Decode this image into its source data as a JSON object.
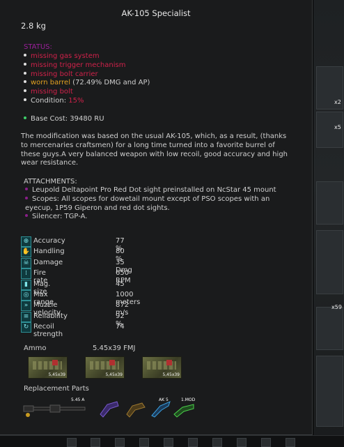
{
  "item": {
    "title": "AK-105 Specialist",
    "weight": "2.8 kg"
  },
  "status": {
    "heading": "STATUS:",
    "lines": [
      {
        "text": "missing gas system",
        "color": "#d0214a"
      },
      {
        "text": "missing trigger mechanism",
        "color": "#d0214a"
      },
      {
        "text": "missing bolt carrier",
        "color": "#d0214a"
      },
      {
        "text": "missing bolt",
        "color": "#d0214a"
      }
    ],
    "worn_label": "worn barrel",
    "worn_value": " (72.49% DMG and AP)",
    "worn_color": "#e0a020",
    "condition_label": "Condition: ",
    "condition_value": "15%",
    "condition_color": "#d0214a"
  },
  "cost": {
    "text": "Base Cost: 39480 RU",
    "dot_color": "#3fcf6a"
  },
  "description": "The modification was based on the usual AK-105, which, as a result, (thanks to mercenaries craftsmen) for a long time turned into a favorite burrel of these guys.A very balanced weapon with low recoil, good accuracy and high wear resistance.",
  "attachments": {
    "heading": "ATTACHMENTS:",
    "items": [
      "Leupold Deltapoint Pro Red Dot sight preinstalled on NcStar 45 mount",
      "Scopes: All scopes for dowetail mount except of PSO scopes with an eyecup, 1P59 Giperon and red dot sights.",
      "Silencer: TGP-A."
    ]
  },
  "stats": [
    {
      "label": "Accuracy",
      "value": "77 %",
      "icon": "crosshair-icon"
    },
    {
      "label": "Handling",
      "value": "80 %",
      "icon": "hand-icon"
    },
    {
      "label": "Damage",
      "value": "35 Dmg",
      "icon": "skull-icon"
    },
    {
      "label": "Fire rate",
      "value": "650 RPM",
      "icon": "bullets-icon"
    },
    {
      "label": "Mag. size",
      "value": "45",
      "icon": "magazine-icon"
    },
    {
      "label": "Max range",
      "value": "1000 meters",
      "icon": "target-icon"
    },
    {
      "label": "Muzzle velocity",
      "value": "872 m/s",
      "icon": "speed-icon"
    },
    {
      "label": "Reliability",
      "value": "92 %",
      "icon": "wrench-icon"
    },
    {
      "label": "Recoil strength",
      "value": "74",
      "icon": "recoil-icon"
    }
  ],
  "ammo": {
    "heading": "Ammo",
    "value": "5.45x39 FMJ",
    "boxes": [
      {
        "caliber": "5,45x39"
      },
      {
        "caliber": "5,45x39"
      },
      {
        "caliber": "5,45x39"
      }
    ]
  },
  "replacement": {
    "heading": "Replacement Parts",
    "parts": [
      {
        "name": "barrel-part",
        "tag": "5.45 A"
      },
      {
        "name": "gas-system-part",
        "tag": ""
      },
      {
        "name": "trigger-part",
        "tag": ""
      },
      {
        "name": "bolt-carrier-part",
        "tag": "AK 5"
      },
      {
        "name": "bolt-part",
        "tag": "1.MOD"
      }
    ]
  },
  "background": {
    "tags": [
      "x2",
      "x5",
      "x59"
    ]
  }
}
